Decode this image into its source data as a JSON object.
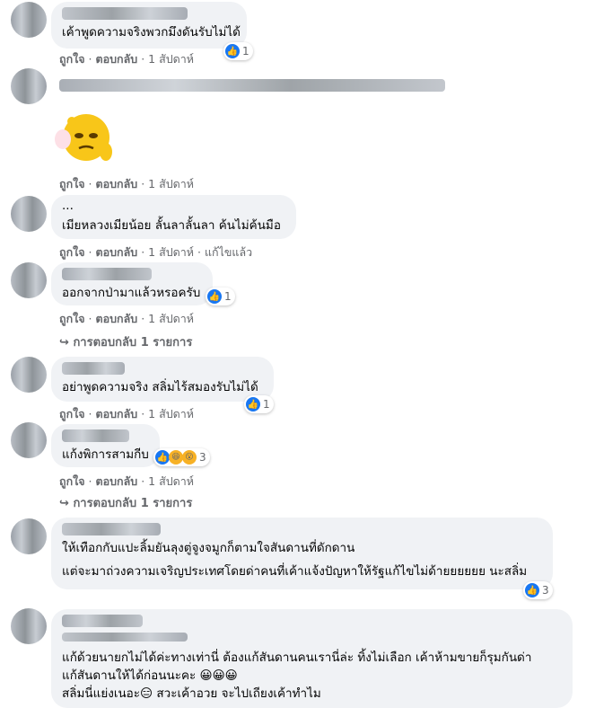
{
  "comments": [
    {
      "text": "เค้าพูดความจริงพวกมึงดันรับไม่ได้",
      "reaction_count": "1",
      "actions": {
        "like": "ถูกใจ",
        "reply": "ตอบกลับ",
        "time": "1 สัปดาห์"
      }
    },
    {
      "text": "",
      "actions": {
        "like": "ถูกใจ",
        "reply": "ตอบกลับ",
        "time": "1 สัปดาห์"
      }
    },
    {
      "text_prefix": "...",
      "text": "เมียหลวงเมียน้อย ลั้นลาลั้นลา ค้นไม่ค้นมือ",
      "actions": {
        "like": "ถูกใจ",
        "reply": "ตอบกลับ",
        "time": "1 สัปดาห์",
        "edited": "แก้ไขแล้ว"
      }
    },
    {
      "text": "ออกจากป่ามาแล้วหรอครับ",
      "reaction_count": "1",
      "actions": {
        "like": "ถูกใจ",
        "reply": "ตอบกลับ",
        "time": "1 สัปดาห์"
      },
      "replies": "การตอบกลับ 1 รายการ"
    },
    {
      "text": "อย่าพูดความจริง สลิ่มไร้สมองรับไม่ได้",
      "reaction_count": "1",
      "actions": {
        "like": "ถูกใจ",
        "reply": "ตอบกลับ",
        "time": "1 สัปดาห์"
      }
    },
    {
      "text": "แก้งพิการสามกีบ",
      "reaction_count": "3",
      "actions": {
        "like": "ถูกใจ",
        "reply": "ตอบกลับ",
        "time": "1 สัปดาห์"
      },
      "replies": "การตอบกลับ 1 รายการ"
    },
    {
      "line1": "ให้เทือกกับแปะลิ้มยันลุงตู่จูงจมูกก็ตามใจสันดานที่ดักดาน",
      "line2": "แต่จะมาถ่วงความเจริญประเทศโดยด่าคนที่เค้าแจ้งปัญหาให้รัฐแก้ไขไม่ด้ายยยยยย นะสลิ่ม",
      "reaction_count": "3"
    },
    {
      "line1": "แก้ด้วยนายกไม่ได้ค่ะทางเท่านี่ ต้องแก้สันดานคนเรานี่ล่ะ ทิ้งไม่เลือก เค้าห้ามขายก็รุมกันด่า",
      "line2": "แก้สันดานให้ได้ก่อนนะคะ 😀😀😀",
      "line3": "สลิ่มนี่แย่งเนอะ😑 สวะเค้าอวย จะไปเถียงเค้าทำไม"
    }
  ],
  "icons": {
    "like": "like-icon",
    "haha": "haha-icon",
    "wow": "wow-icon",
    "reply_arrow": "reply-arrow-icon"
  },
  "colors": {
    "bubble": "#f0f2f5",
    "meta": "#65676b",
    "like": "#1877f2"
  }
}
